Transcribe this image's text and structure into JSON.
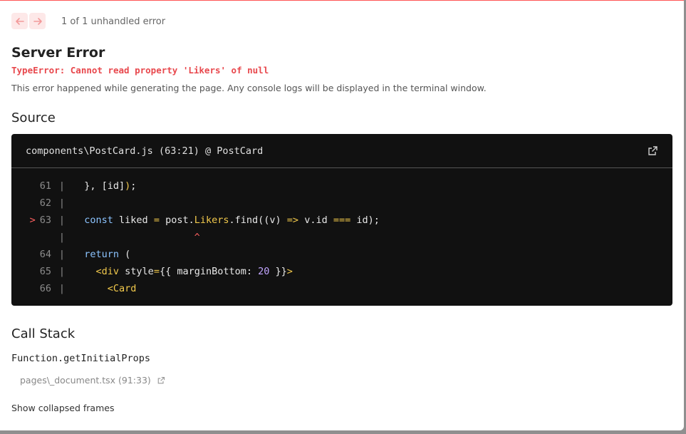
{
  "nav": {
    "prev_icon": "arrow-left",
    "next_icon": "arrow-right",
    "counter": "1 of 1 unhandled error"
  },
  "error": {
    "title": "Server Error",
    "message": "TypeError: Cannot read property 'Likers' of null",
    "description": "This error happened while generating the page. Any console logs will be displayed in the terminal window."
  },
  "source": {
    "heading": "Source",
    "file": "components\\PostCard.js (63:21) @ PostCard",
    "lines": [
      {
        "num": "61",
        "code": "  }, [id]);"
      },
      {
        "num": "62",
        "code": ""
      },
      {
        "num": "63",
        "code": "  const liked = post.Likers.find((v) => v.id === id);",
        "marker": ">"
      },
      {
        "num": "",
        "code": "                     ^"
      },
      {
        "num": "64",
        "code": "  return ("
      },
      {
        "num": "65",
        "code": "    <div style={{ marginBottom: 20 }}>"
      },
      {
        "num": "66",
        "code": "      <Card"
      }
    ]
  },
  "callstack": {
    "heading": "Call Stack",
    "function": "Function.getInitialProps",
    "file": "pages\\_document.tsx (91:33)",
    "show_collapsed": "Show collapsed frames"
  },
  "colors": {
    "accent": "#ff5555",
    "error_text": "#e8484d",
    "code_bg": "#111111"
  }
}
